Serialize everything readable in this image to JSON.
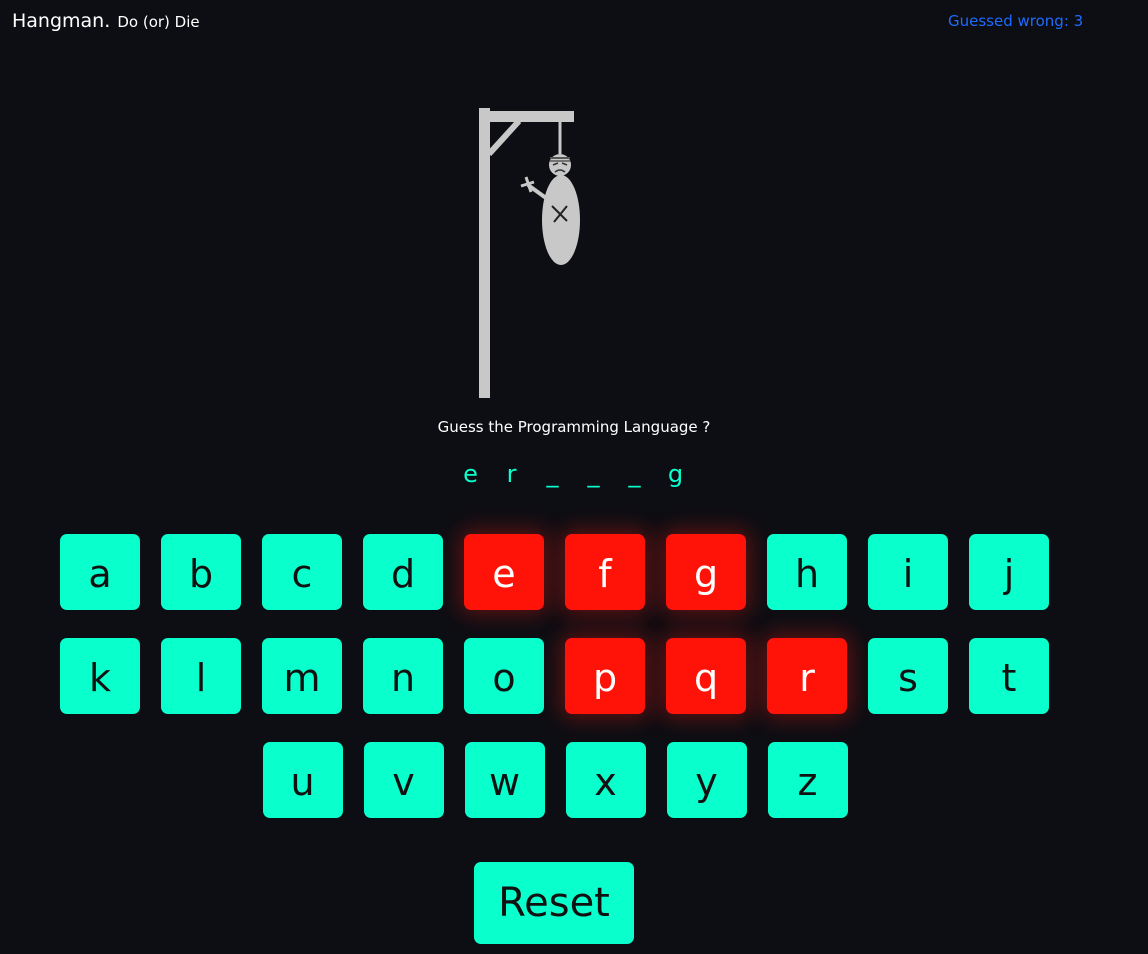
{
  "header": {
    "title": "Hangman.",
    "tagline": "Do (or) Die",
    "wrong_label": "Guessed wrong: 3"
  },
  "game": {
    "prompt": "Guess the Programming Language ?",
    "word_slots": [
      "e",
      "r",
      "_",
      "_",
      "_",
      "g"
    ],
    "wrong_count": 3
  },
  "keyboard": {
    "rows": [
      [
        {
          "letter": "a",
          "state": "unused"
        },
        {
          "letter": "b",
          "state": "unused"
        },
        {
          "letter": "c",
          "state": "unused"
        },
        {
          "letter": "d",
          "state": "unused"
        },
        {
          "letter": "e",
          "state": "guessed"
        },
        {
          "letter": "f",
          "state": "guessed"
        },
        {
          "letter": "g",
          "state": "guessed"
        },
        {
          "letter": "h",
          "state": "unused"
        },
        {
          "letter": "i",
          "state": "unused"
        },
        {
          "letter": "j",
          "state": "unused"
        }
      ],
      [
        {
          "letter": "k",
          "state": "unused"
        },
        {
          "letter": "l",
          "state": "unused"
        },
        {
          "letter": "m",
          "state": "unused"
        },
        {
          "letter": "n",
          "state": "unused"
        },
        {
          "letter": "o",
          "state": "unused"
        },
        {
          "letter": "p",
          "state": "guessed"
        },
        {
          "letter": "q",
          "state": "guessed"
        },
        {
          "letter": "r",
          "state": "guessed"
        },
        {
          "letter": "s",
          "state": "unused"
        },
        {
          "letter": "t",
          "state": "unused"
        }
      ],
      [
        {
          "letter": "u",
          "state": "unused"
        },
        {
          "letter": "v",
          "state": "unused"
        },
        {
          "letter": "w",
          "state": "unused"
        },
        {
          "letter": "x",
          "state": "unused"
        },
        {
          "letter": "y",
          "state": "unused"
        },
        {
          "letter": "z",
          "state": "unused"
        }
      ]
    ]
  },
  "actions": {
    "reset_label": "Reset"
  },
  "colors": {
    "background": "#0d0e13",
    "key_default": "#09ffcc",
    "key_guessed": "#ff1308",
    "counter_text": "#1e6bff",
    "gallows": "#c8c8c8"
  }
}
